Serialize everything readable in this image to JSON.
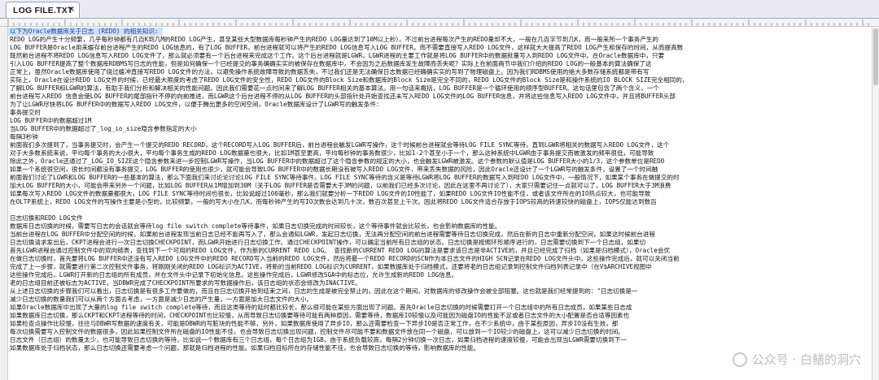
{
  "tab": {
    "title": "LOG FILE.TXT",
    "close": "×"
  },
  "lines": [
    "以下为Oracle数据库关于日志 (REDO) 的相关知识:",
    "REDO LOG的产生十分频繁，几乎每秒钟都有几百K到几M的REDO LOG产生，甚至某些大型数据库每秒钟产生的REDO LOG量达到了10M以上秒）。不过前台进程每次产生的REDO量却不大，一般在几百字节到几K，而一般来所一个事务产生的",
    "LOG BUFFER是Oracle用来缓存前台进程产生的REDO LOG信息的，有了LOG BUFFER，前台进程就可以将产生的REDO LOG信息写入LOG BUFFER，而不需要直接写入REDO LOG文件，这样就大大提高了REDO LOG产生和保存的时间，从而提高数",
    "既然前台进程不将REDO LOG信息写入REDO LOG文件了，那么就必须要有一个后台进程来完成这个工作。这个后台进程就是LGWR，LGWR进程的主要工作就是将LOG BUFFER中的数据批量写入到REDO LOG文件中。在Oracle数据库中，只要",
    "引入LOG BUFFER提高了整个数据库RDBMS写日志的性能，但是如何确保一个已经提交的事务确确实实的被保存在数据库中，不会因为之后数据库发生故障而丢失呢？实际上在前面两节中我们介绍的REDO LOG的一般基本的算法确保了这",
    "正常上，虽然Oracle数据库使用了绕过缓冲直接写REDO LOG文件的方法，以避免操作系统故障导致的数据丢失，不过我们还是无法确保日志数据已经确确实实的写到了物理磁盘上。因为我们RDBMS使用的绝大多数存储系统都是带有写",
    "实际上，Oracle在设计REDO LOG文件的时候，已经最大限度的考虑了REDO LOG文件的安全性，REDO LOG文件的Block Size和数据库的Block Size是完全不同的，REDO LOG文件的Block Size是和操作系统的IO BLOCK SIZE完全相同的，",
    "了解LOG BUFFER和LGWR的算法，有助于我们分析和解决相关的性能问题。因此我们需要花一点时间来了解LOG BUFFER相关的基本算法。用一句话来概括，LOG BUFFER是一个循环使用的顺序型BUFFER。这句话里包含了两个含义，一个",
    "前台进程写入REDO 信息会使LOG BUFFER的尾部指针不停的向前推进，而LGWR这个后台进程不停的从LOG BUFFER的头部指针处开始查找还未写入REDO LOG文件的LOG BUFFER信息，并将这些信息写入REDO LOG文件中，并且将BUFFER头部",
    "为了让LGWR尽快将LOG BUFFER中的数据写入REDO LOG文件，以便于腾出更多的空闲空间，Oracle数据库设计了LGWR写的触发条件：",
    "    事务提交时",
    "    LOG BUFFER中的数据超过1M",
    "    当LOG BUFFER中的数据超过了_log_io_size隐含参数指定的大小",
    "    每隔3秒钟",
    "前面我们多次提到了，当事务提交时，会产生一个提交的REDO RECORD，这个RECORD写入LOG BUFFER后，前台进程会触发LGWR写操作，这个时候前台进程就会等待LOG FILE SYNC等待，直到LGWR将相关的数据写入REDO LOG文件，这个",
    "对于大多数系统来说，平均每个事务的大小很大，平均每个事务生成的REDO LOG数据量也很大，比如1M甚至更高，平均每秒钟的事务数很少，比如1-2个甚至小于一个，那么这种系统中LGWR由于事务提交而被激发的频率很低，可能导致",
    "除此之外，Oracle还通过了_LOG_IO_SIZE这个隐含参数来进一步控制LGWR写操作，当LOG BUFFER中的数据超过了这个隐含参数的规定的大小，也会触发LGWR被激发。这个参数的默认值是LOG BUFFER大小的1/3，这个参数单位是REDO",
    "如果一个系统很空闲，很长时间都没有事务提交，LOG BUFFER的使用也很少，就可能会导致LOG BUFFER中的数据长期没有被写入REDO LOG文件，带来丢失数据的风险，因此Oracle还设计了一个LGWR写的触发条件，设置了一个时间触",
    "前面我们讨论了LGWR和LOG BUFFER的一些基本的算法，那么下面我们来讨论论讨论LOG FILE SYNC等待事件。LOG FILE SYNC等待的含义是等待LGWR将LOG BUFFER的数据写入到REDO LOG文件中，一般情况下，如果某个事务在做提交的时",
    "加大LOG BUFFER的大小，可能会带来另外一个问题，比如LOG BUFFER从1M增加到30M（关于LOG BUFFER是否需要大于3M的问题，以前我们已经多次讨论，因此在这里不再讨论了），大家只需要记住一点就可以了，LOG BUFFER大于3M浪费",
    "如果每次写入REDO LOG文件的数据量都很大，LOG FILE SYNC等待时间也很长，比如说超过100毫秒，那么我们就要分析一下REDO LOG文件的IO性能了，如果REDO LOG文件IO性能不佳，或者该文件所在的IO热点较大，也可能导致",
    "在OLTP系统上，REDO LOG文件的写操作主要是小型的，比较频繁，一般的写大小在几K，而每秒钟产生的写IO次数会达到几十次，数百次甚至上千次。因此将REDO LOG文件适合存放于IOPS较高的转速较快的磁盘上，IOPS仅能达到数百",
    "",
    "日志切换和REDO LOG文件",
    "数据库日志切换的时候，需要写日志的会话就会等待log file switch complete等待事件，如果日志切换完成的时间较长，这个等待事件就会比较长，也会影响数据库的性能。",
    "当前台进程在LOG BUFFER中分配空间的时候，如果前台进程发现当前日志已经不能再写入了，那么会通知LGWR，发起日志切换，无法再分配空间的前台进程需要等待日志切换完成，然后在新的日志中重新分配空间，如果这时候前台进程",
    "日志切换请求发出后，CKPT进程会进行一次日志切换CHECKPOINT，而LGWR开始进行日志切换工作。通过CHECKPOINT操作，可以确定当前所有日志组的状态。日志切换是按照环形顺序进行的，日志需要切换到下一个日志组，如果切",
    "首先LGWR进程会通过控制文件中的双向链表，查找到下一个可用的REDO LOG文件，作为新的CURRENT REDO LOG。   查找新的CURRENT REDO LOG的算法是要求该日志是非ACTIVE的，并且已经完成了归档（如果是归档模式），Oracle会优",
    "在做日志切换时，首先要将LOG BUFFER中还没有写入REDO LOG文件中的REDO RECORD写入当前的REDO LOG文件，然后将最一个REDO RECORD的SCN作为本日志文件的HIGH SCN记录在REDO LOG文件头中。这些操作完成后，就可以关闭当前",
    "完成了上一步骤，就需要进行第二次控制文件事务，将刚刚关闭的REDO LOG标识为ACTIVE，将新的当前REDO LOG标识为CURRENT，如果数据库处于归档模式，还要将老的日志组记录到控制文件归档列表记录中（在V$ARCHIVE视图中",
    "这些操作完成后，LGWR打开新的日志组的所有成员，并在文件头中记录下初始化信息。这些操作完成后，LGWR修改SGA中的标志位，允许生成新的REDO LOG信息。",
    "老的日志组目前还被标志为ACTIVE，当DBWR完成了CHECKPOINT所要求的写数据操作后，该日志组的状态会修改为INACTIVE。",
    "从上述日志切换的步骤我们可以看出，日志切换是有很多工作要做的，而且在日志切换开始到结束之间，日志的生成是被完全禁止的，因此在这个期间，对数据库的修改操作会被全部阻塞。这也就是我们经常提到的：\"日志切换是一",
    "减少日志切换的数量我们可以从两个方面去考虑，一方面是减少日志的产生量，一方面是加大日志文件的大小。",
    "如果Oracle数据库中出现了大量的log file switch complete等待，而且这类等待的延时都比较长，那么很可能在某些方面出现了问题。首先Oracle日志切换的时候需要打开一个日志组中的所有日志成员，如果某些日志成",
    "如果数据库日志切换，那么CKPT和CKPT进程等待的时间，CHECKPOINT也比较慢，从而导致日志切换要等待可能有两种原因，需要等待，数据库IO较慢以及可能因为磁盘IO的性能不足或者日志文件的大小配置是否合适等因素也",
    "如果检查点操作比较慢，往往与DBWR写数据的速度有关，可能是DBWR的写脏块的性能不够，另外，如果数据库使用了异步IO，那么还需要检查一下异步IO是否正常工作，在不少系统中，由于某些原因，异步IO没有生效，那",
    "每次切换需要写入控制文件的数据很多，因此如果控制文件所在磁盘的IO性能不佳，也会导致日志切换出现问题，控制文件尽可能不要和数据文件放在同一个磁盘，可以放到一个IO较少的磁盘上，这可以减少日志切换的时间。",
    "日志文件（日志组）的数量太少，也可能导致日志切换的等待，比如说一个数据库有三个日志组，每个日志组为1GB，由于系统负载较高，每隔2分钟切换一次日志，如果归档进程的速度较慢，可能会出现当LGWR需要切换到下一",
    "如果数据库处于归档状态，那么日志切换还需要考虑一个问题，那就是归档进程的性能。如果归档目标所在的存储性能不佳，也会导致日志切换的等待，影响数据库的性能。"
  ],
  "watermark": {
    "text": "公众号 · 白鳝的洞穴"
  }
}
